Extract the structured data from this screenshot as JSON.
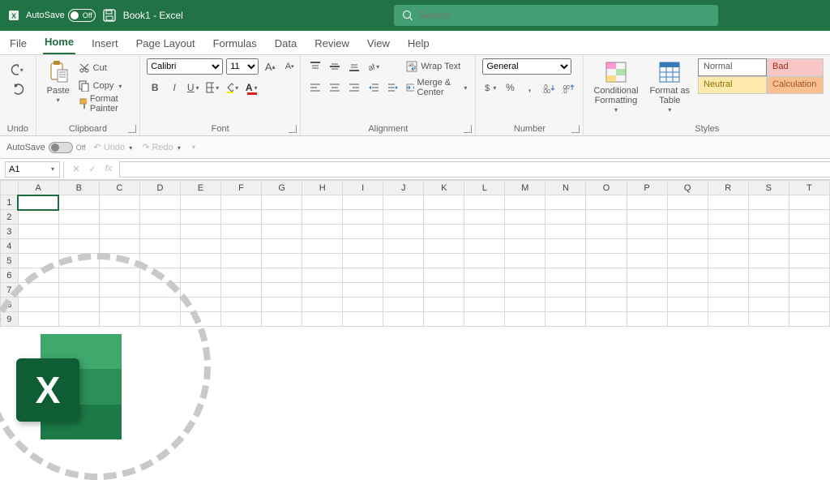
{
  "titlebar": {
    "autosave_label": "AutoSave",
    "autosave_state": "Off",
    "document_title": "Book1 - Excel",
    "search_placeholder": "Search"
  },
  "tabs": {
    "items": [
      "File",
      "Home",
      "Insert",
      "Page Layout",
      "Formulas",
      "Data",
      "Review",
      "View",
      "Help"
    ],
    "active": "Home"
  },
  "ribbon": {
    "undo": {
      "label": "Undo"
    },
    "clipboard": {
      "label": "Clipboard",
      "paste": "Paste",
      "cut": "Cut",
      "copy": "Copy",
      "fmtpainter": "Format Painter"
    },
    "font": {
      "label": "Font",
      "name": "Calibri",
      "size": "11"
    },
    "alignment": {
      "label": "Alignment",
      "wrap": "Wrap Text",
      "merge": "Merge & Center"
    },
    "number": {
      "label": "Number",
      "format": "General"
    },
    "styles": {
      "label": "Styles",
      "cond": "Conditional\nFormatting",
      "fat": "Format as\nTable",
      "normal": "Normal",
      "bad": "Bad",
      "neutral": "Neutral",
      "calc": "Calculation"
    }
  },
  "qat2": {
    "autosave_label": "AutoSave",
    "autosave_state": "Off",
    "undo": "Undo",
    "redo": "Redo"
  },
  "formula_bar": {
    "namebox": "A1",
    "fx": "fx"
  },
  "grid": {
    "columns": [
      "A",
      "B",
      "C",
      "D",
      "E",
      "F",
      "G",
      "H",
      "I",
      "J",
      "K",
      "L",
      "M",
      "N",
      "O",
      "P",
      "Q",
      "R",
      "S",
      "T"
    ],
    "rows": [
      "1",
      "2",
      "3",
      "4",
      "5",
      "6",
      "7",
      "8",
      "9"
    ],
    "selected": "A1"
  },
  "logo": {
    "letter": "X"
  }
}
